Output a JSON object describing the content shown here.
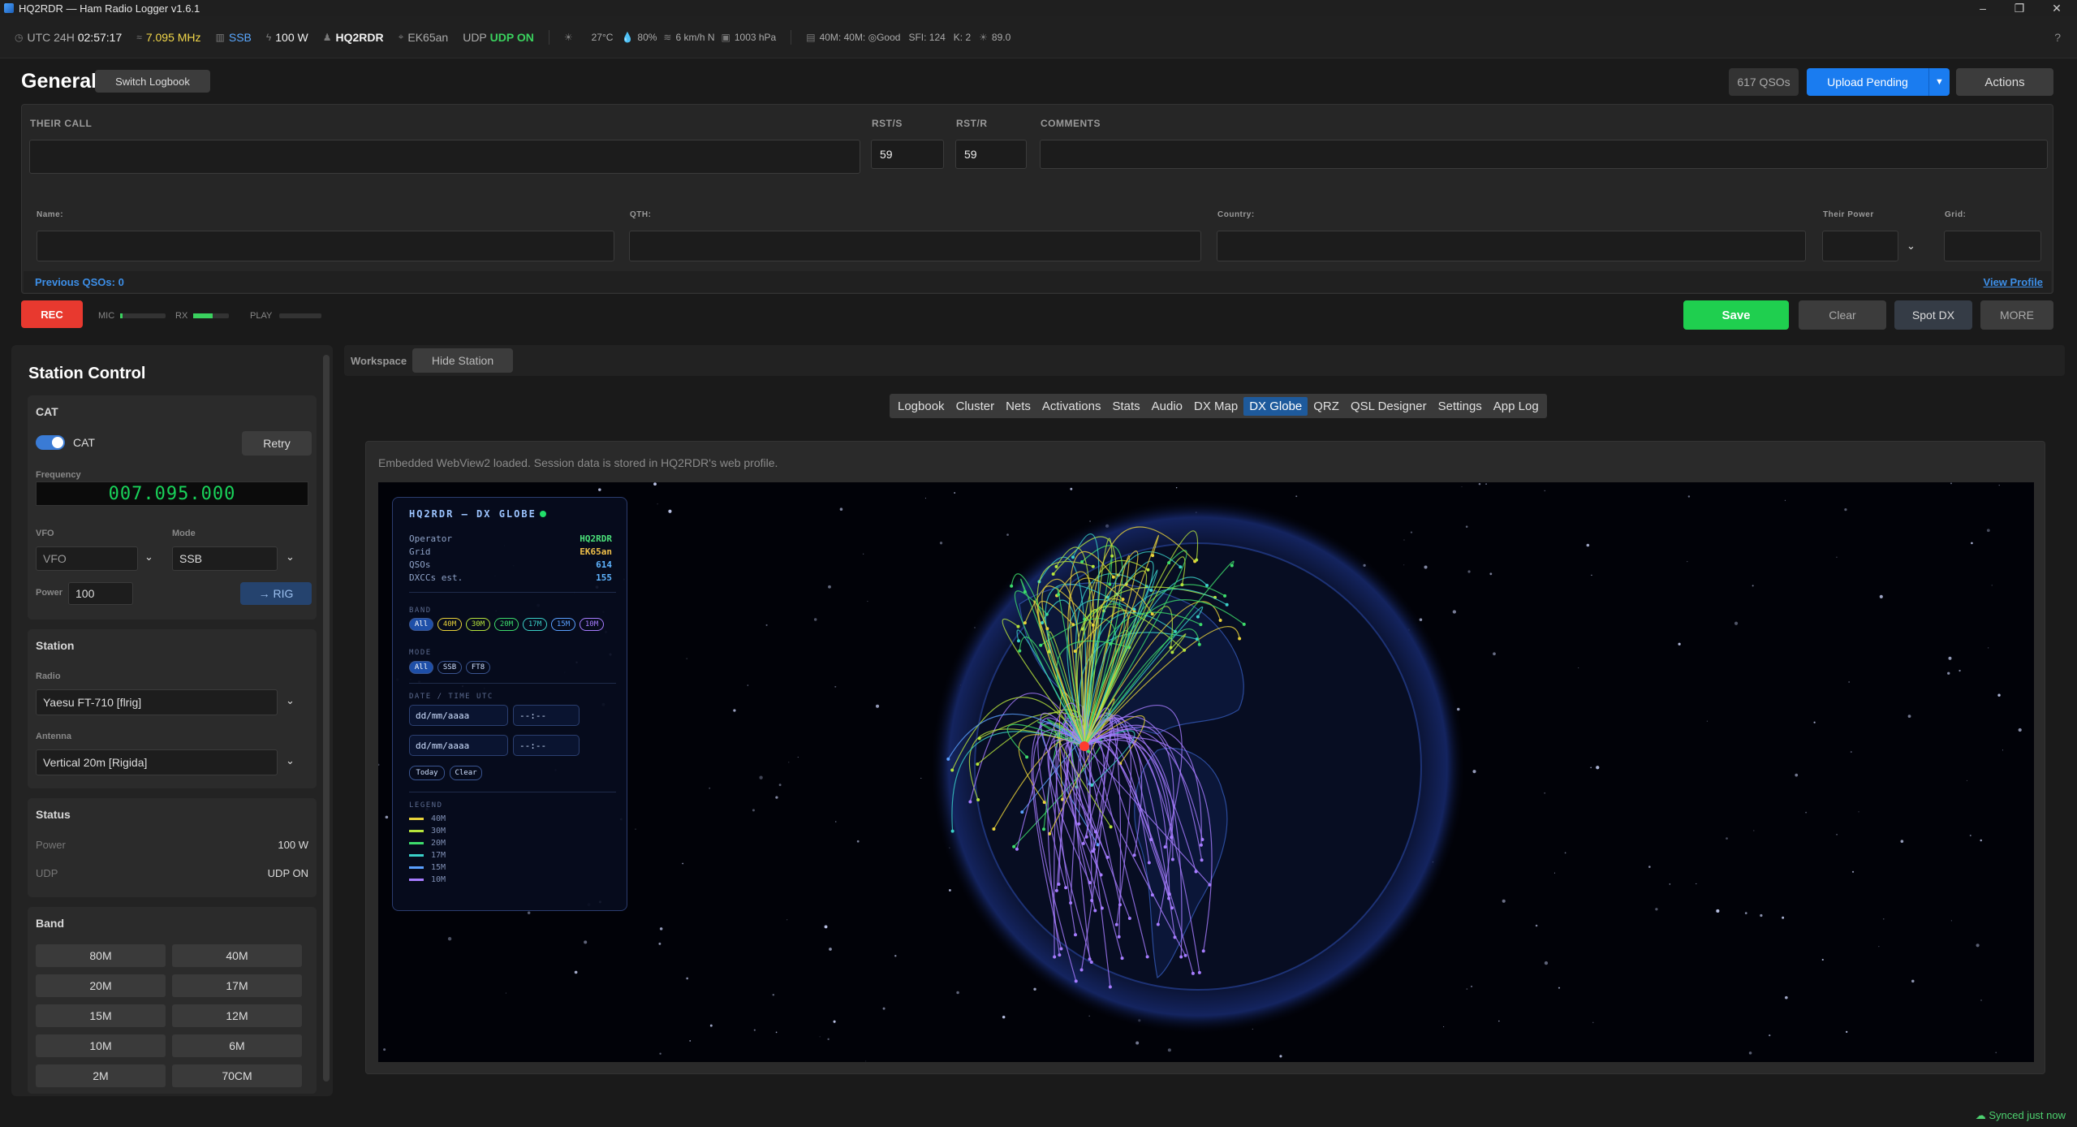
{
  "window": {
    "title": "HQ2RDR — Ham Radio Logger v1.6.1"
  },
  "status": {
    "clock_label": "UTC 24H",
    "clock": "02:57:17",
    "freq": "7.095 MHz",
    "mode": "SSB",
    "power": "100 W",
    "callsign": "HQ2RDR",
    "grid": "EK65an",
    "udp_label": "UDP",
    "udp": "UDP ON",
    "temp": "27°C",
    "humidity": "80%",
    "wind": "6 km/h N",
    "pressure": "1003 hPa",
    "prop": "40M: 40M: ◎Good",
    "sfi": "SFI: 124",
    "k": "K: 2",
    "flux": "89.0",
    "help": "?"
  },
  "header": {
    "title": "General",
    "switch_logbook": "Switch Logbook",
    "qso_count": "617 QSOs",
    "upload": "Upload Pending",
    "actions": "Actions"
  },
  "form": {
    "their_call_label": "THEIR CALL",
    "rsts_label": "RST/S",
    "rstr_label": "RST/R",
    "comments_label": "COMMENTS",
    "rsts": "59",
    "rstr": "59",
    "name_label": "Name:",
    "qth_label": "QTH:",
    "country_label": "Country:",
    "power_label": "Their Power",
    "grid_label": "Grid:",
    "prev_qsos": "Previous QSOs: 0",
    "view_profile": "View Profile"
  },
  "recorder": {
    "rec": "REC",
    "mic": "MIC",
    "rx": "RX",
    "play": "PLAY",
    "mic_level": 0.05,
    "rx_level": 0.55,
    "play_level": 0.0
  },
  "actions": {
    "save": "Save",
    "clear": "Clear",
    "spot": "Spot DX",
    "more": "MORE"
  },
  "station_control": {
    "title": "Station Control",
    "cat": {
      "title": "CAT",
      "toggle_label": "CAT",
      "enabled": true,
      "retry": "Retry",
      "freq_label": "Frequency",
      "freq": "007.095.000",
      "vfo_label": "VFO",
      "vfo": "VFO",
      "mode_label": "Mode",
      "mode": "SSB",
      "power_label": "Power",
      "power": "100",
      "to_rig": "→ RIG"
    },
    "station": {
      "title": "Station",
      "radio_label": "Radio",
      "radio": "Yaesu FT-710 [flrig]",
      "antenna_label": "Antenna",
      "antenna": "Vertical 20m [Rigida]"
    },
    "status": {
      "title": "Status",
      "power_label": "Power",
      "power": "100 W",
      "udp_label": "UDP",
      "udp": "UDP ON"
    },
    "band": {
      "title": "Band",
      "buttons": [
        "80M",
        "40M",
        "20M",
        "17M",
        "15M",
        "12M",
        "10M",
        "6M",
        "2M",
        "70CM"
      ]
    }
  },
  "workspace": {
    "label": "Workspace",
    "hide_station": "Hide Station",
    "tabs": [
      "Logbook",
      "Cluster",
      "Nets",
      "Activations",
      "Stats",
      "Audio",
      "DX Map",
      "DX Globe",
      "QRZ",
      "QSL Designer",
      "Settings",
      "App Log"
    ],
    "active_tab": "DX Globe",
    "note": "Embedded WebView2 loaded. Session data is stored in HQ2RDR's web profile."
  },
  "globe_panel": {
    "title": "HQ2RDR — DX GLOBE",
    "stats": [
      {
        "k": "Operator",
        "v": "HQ2RDR",
        "c": "#4be07a"
      },
      {
        "k": "Grid",
        "v": "EK65an",
        "c": "#f0c04a"
      },
      {
        "k": "QSOs",
        "v": "614",
        "c": "#5fb4ff"
      },
      {
        "k": "DXCCs est.",
        "v": "155",
        "c": "#5fb4ff"
      }
    ],
    "band_label": "BAND",
    "bands": [
      "All",
      "40M",
      "30M",
      "20M",
      "17M",
      "15M",
      "10M"
    ],
    "mode_label": "MODE",
    "modes": [
      "All",
      "SSB",
      "FT8"
    ],
    "date_label": "DATE / TIME UTC",
    "date_placeholder": "dd/mm/aaaa",
    "time_placeholder": "--:--",
    "today": "Today",
    "clear": "Clear",
    "legend_label": "LEGEND",
    "legend": [
      {
        "band": "40M",
        "color": "#e8d23a"
      },
      {
        "band": "30M",
        "color": "#b6e43c"
      },
      {
        "band": "20M",
        "color": "#3ddc6c"
      },
      {
        "band": "17M",
        "color": "#3ad0c8"
      },
      {
        "band": "15M",
        "color": "#5aa0ff"
      },
      {
        "band": "10M",
        "color": "#a67cff"
      }
    ]
  },
  "footer": {
    "synced": "Synced just now"
  }
}
